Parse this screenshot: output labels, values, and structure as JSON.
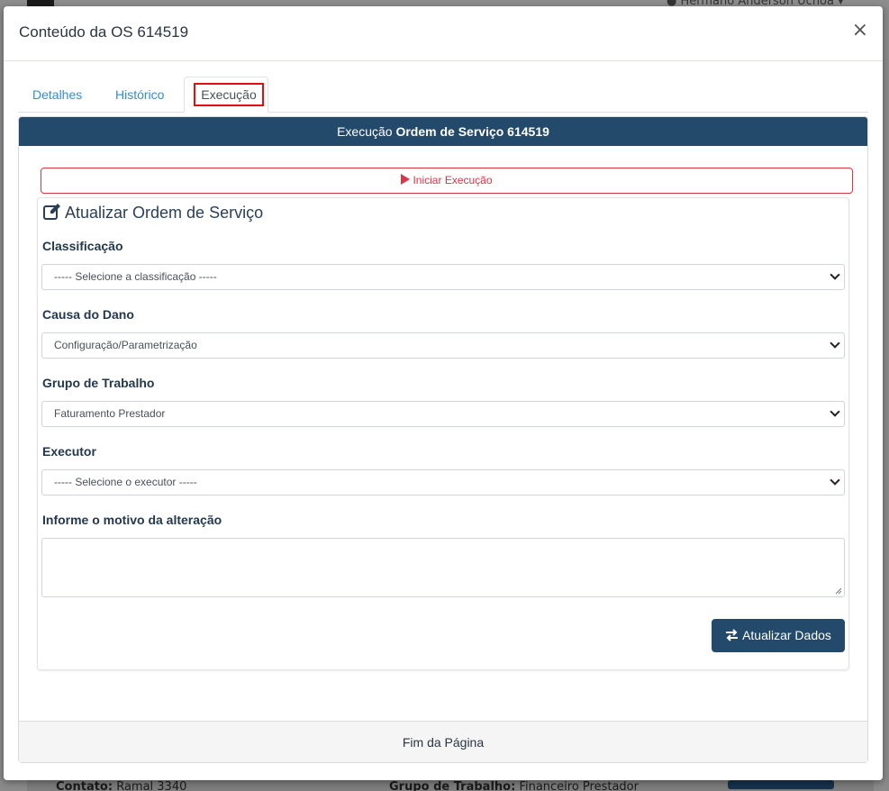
{
  "background": {
    "user_name": "Hermano Anderson Uchoa",
    "contato_label": "Contato:",
    "contato_value": "Ramal 3340",
    "grupo_label": "Grupo de Trabalho:",
    "grupo_value": "Financeiro Prestador"
  },
  "modal": {
    "title": "Conteúdo da OS 614519",
    "close": "×"
  },
  "tabs": [
    {
      "label": "Detalhes"
    },
    {
      "label": "Histórico"
    },
    {
      "label": "Execução",
      "active": true
    }
  ],
  "card": {
    "header_prefix": "Execução",
    "header_bold": "Ordem de Serviço 614519",
    "start_button": "Iniciar Execução",
    "footer": "Fim da Página"
  },
  "form": {
    "title": "Atualizar Ordem de Serviço",
    "classificacao": {
      "label": "Classificação",
      "value": "----- Selecione a classificação -----"
    },
    "causa": {
      "label": "Causa do Dano",
      "value": "Configuração/Parametrização"
    },
    "grupo": {
      "label": "Grupo de Trabalho",
      "value": "Faturamento Prestador"
    },
    "executor": {
      "label": "Executor",
      "value": "----- Selecione o executor -----"
    },
    "motivo": {
      "label": "Informe o motivo da alteração",
      "value": ""
    },
    "submit": "Atualizar Dados"
  },
  "colors": {
    "primary_dark": "#234a6a",
    "link": "#2f8ed3",
    "danger": "#dc3545",
    "highlight": "#e01010"
  }
}
